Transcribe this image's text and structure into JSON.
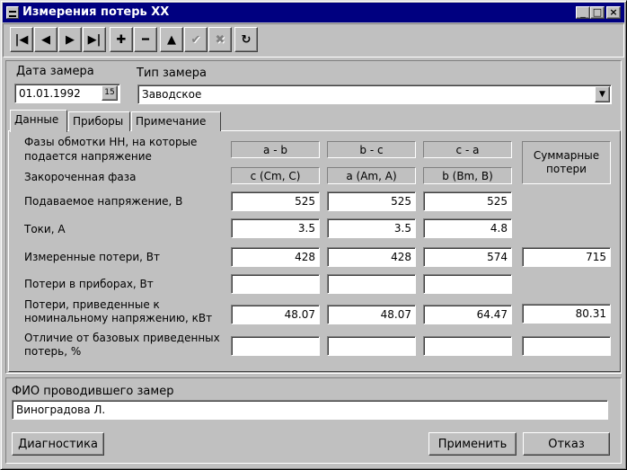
{
  "window": {
    "title": "Измерения потерь XX",
    "minimize_glyph": "_",
    "maximize_glyph": "□",
    "close_glyph": "×"
  },
  "toolbar": {
    "first": "|◀",
    "prior": "◀",
    "next": "▶",
    "last": "▶|",
    "insert": "✚",
    "delete": "━",
    "edit": "▲",
    "post": "✔",
    "cancel": "✖",
    "refresh": "↻"
  },
  "header": {
    "date_label": "Дата замера",
    "date_value": "01.01.1992",
    "calendar_glyph": "15",
    "type_label": "Тип замера",
    "type_value": "Заводское"
  },
  "tabs": [
    "Данные",
    "Приборы",
    "Примечание"
  ],
  "grid": {
    "phases_label": "Фазы обмотки НН, на которые подается напряжение",
    "phases": [
      "a - b",
      "b - c",
      "c - a"
    ],
    "shorted_label": "Закороченная фаза",
    "shorted": [
      "c (Cm, C)",
      "a (Am, A)",
      "b (Bm, B)"
    ],
    "total_header": "Суммарные потери",
    "rows": [
      {
        "label": "Подаваемое напряжение, В",
        "values": [
          "525",
          "525",
          "525"
        ],
        "total": null
      },
      {
        "label": "Токи, А",
        "values": [
          "3.5",
          "3.5",
          "4.8"
        ],
        "total": null
      },
      {
        "label": "Измеренные потери, Вт",
        "values": [
          "428",
          "428",
          "574"
        ],
        "total": "715"
      },
      {
        "label": "Потери в приборах, Вт",
        "values": [
          "",
          "",
          ""
        ],
        "total": null
      },
      {
        "label": "Потери, приведенные к номинальному напряжению, кВт",
        "values": [
          "48.07",
          "48.07",
          "64.47"
        ],
        "total": "80.31"
      },
      {
        "label": "Отличие от базовых приведенных потерь, %",
        "values": [
          "",
          "",
          ""
        ],
        "total": ""
      }
    ]
  },
  "footer": {
    "person_label": "ФИО проводившего замер",
    "person_value": "Виноградова Л.",
    "diagnostics": "Диагностика",
    "apply": "Применить",
    "cancel": "Отказ"
  }
}
